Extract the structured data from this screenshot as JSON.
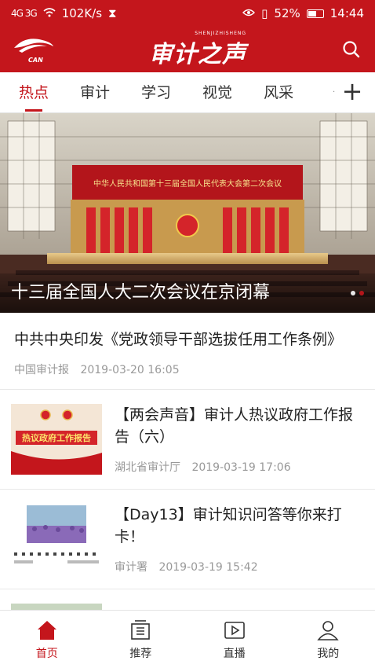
{
  "status_bar": {
    "signal": "4G 3G",
    "speed": "102K/s",
    "battery": "52%",
    "time": "14:44"
  },
  "header": {
    "logo_text": "CAN",
    "brand_sub": "SHENJIZHISHENG",
    "brand_title": "审计之声",
    "search_icon": "search-icon"
  },
  "tabs": [
    "热点",
    "审计",
    "学习",
    "视觉",
    "风采"
  ],
  "banner": {
    "caption": "十三届全国人大二次会议在京闭幕",
    "screen_text": "中华人民共和国第十三届全国人民代表大会第二次会议"
  },
  "articles": [
    {
      "title": "中共中央印发《党政领导干部选拔任用工作条例》",
      "source": "中国审计报",
      "time": "2019-03-20 16:05"
    },
    {
      "title": "【两会声音】审计人热议政府工作报告（六）",
      "source": "湖北省审计厅",
      "time": "2019-03-19 17:06",
      "thumb_text": "热议政府工作报告"
    },
    {
      "title": "【Day13】审计知识问答等你来打卡！",
      "source": "审计署",
      "time": "2019-03-19 15:42"
    }
  ],
  "bottom_nav": [
    {
      "label": "首页",
      "icon": "home-icon"
    },
    {
      "label": "推荐",
      "icon": "recommend-icon"
    },
    {
      "label": "直播",
      "icon": "live-icon"
    },
    {
      "label": "我的",
      "icon": "profile-icon"
    }
  ],
  "colors": {
    "brand_red": "#c4161c"
  }
}
